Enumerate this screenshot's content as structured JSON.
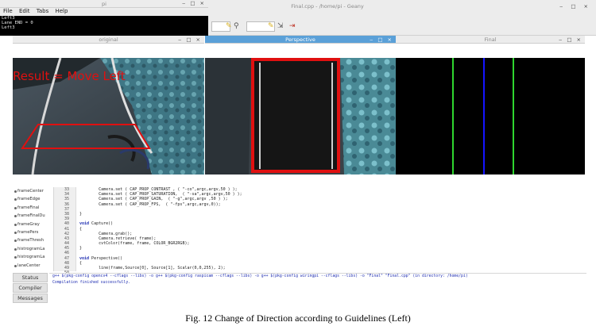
{
  "terminal": {
    "title": "pi",
    "controls": "‒ □ ×",
    "menu": [
      "File",
      "Edit",
      "Tabs",
      "Help"
    ],
    "output": [
      "Left3",
      "Lane END = 0",
      "Left3"
    ]
  },
  "geany": {
    "title": "Final.cpp - /home/pi - Geany",
    "controls": "‒ □ ×"
  },
  "windows": {
    "original": {
      "title": "original",
      "controls": "‒ □ ×",
      "overlay_text": "Result =  Move Left"
    },
    "perspective": {
      "title": "Perspective",
      "controls": "‒ □ ×"
    },
    "final": {
      "title": "Final",
      "controls": "‒ □ ×"
    }
  },
  "symbols": [
    "frameCenter",
    "frameEdge",
    "frameFinal",
    "frameFinalDu",
    "frameGray",
    "framePers",
    "frameThresh",
    "histrogramLa",
    "histrogramLa",
    "laneCenter"
  ],
  "editor": {
    "line_numbers": [
      "33",
      "34",
      "35",
      "36",
      "37",
      "38",
      "39",
      "40",
      "41",
      "42",
      "43",
      "44",
      "45",
      "46",
      "47",
      "48",
      "49",
      "50"
    ],
    "lines": [
      "        Camera.set ( CAP_PROP_CONTRAST , ( \"-co\",argc,argv,50 ) );",
      "        Camera.set ( CAP_PROP_SATURATION,  ( \"-sa\",argc,argv,50 ) );",
      "        Camera.set ( CAP_PROP_GAIN,  ( \"-g\",argc,argv ,50 ) );",
      "        Camera.set ( CAP_PROP_FPS,  ( \"-fps\",argc,argv,0));",
      "",
      "}",
      "",
      "void Capture()",
      "{",
      "        Camera.grab();",
      "        Camera.retrieve( frame);",
      "        cvtColor(frame, frame, COLOR_BGR2RGB);",
      "}",
      "",
      "void Perspective()",
      "{",
      "        line(frame,Source[0], Source[1], Scalar(0,0,255), 2);",
      ""
    ]
  },
  "messages": {
    "tabs": [
      "Status",
      "Compiler",
      "Messages"
    ],
    "lines": [
      "g++ $(pkg-config opencv4 --cflags --libs) -o g++ $(pkg-config raspicam --cflags --libs) -o g++ $(pkg-config wiringpi --cflags --libs) -o \"Final\" \"Final.cpp\" (in directory: /home/pi)",
      "Compilation finished successfully."
    ]
  },
  "caption": "Fig. 12 Change of Direction according to Guidelines (Left)",
  "colors": {
    "overlay_red": "#e01010",
    "lane_green": "#2fd62f",
    "lane_blue": "#1414ff",
    "active_titlebar": "#5aa0d8"
  }
}
